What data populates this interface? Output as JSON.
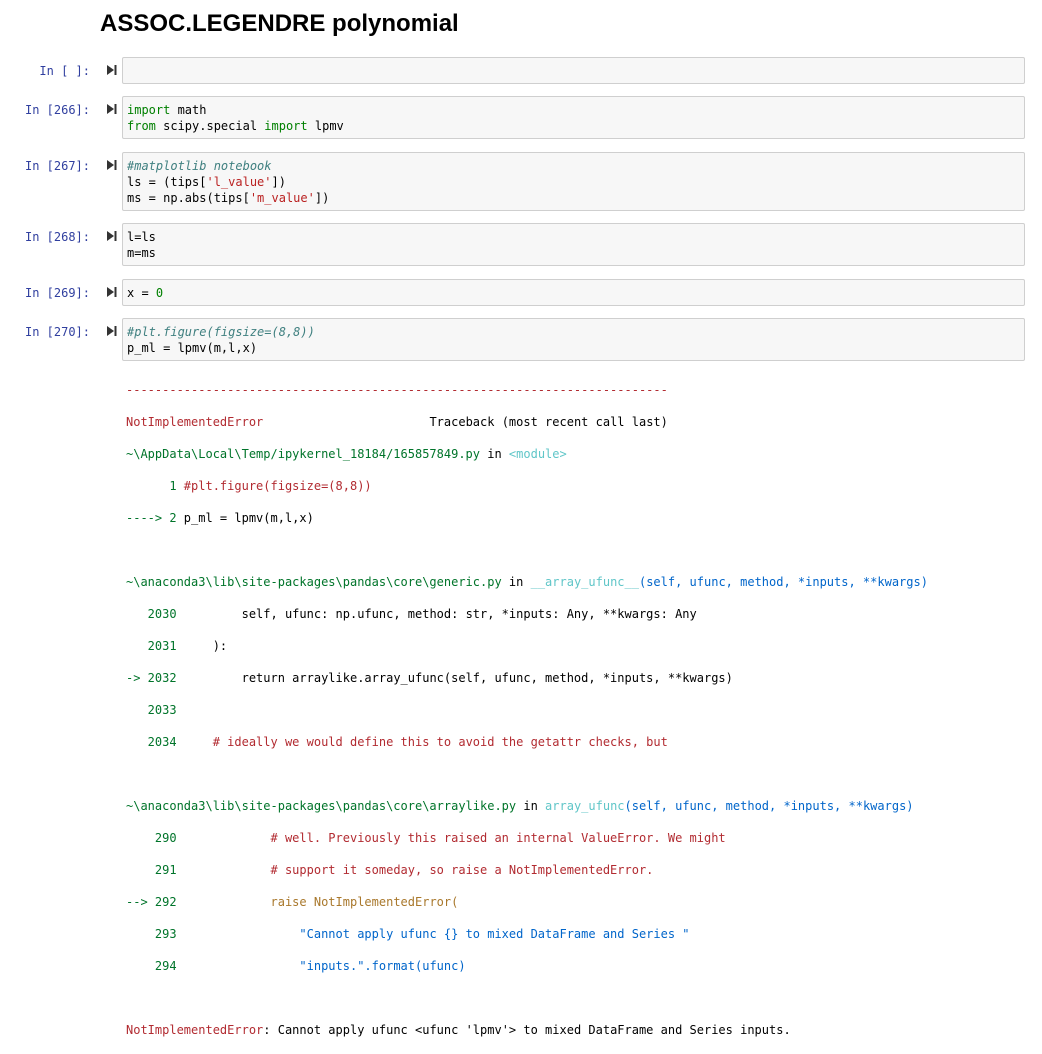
{
  "notebook": {
    "title": "ASSOC.LEGENDRE polynomial",
    "cells": [
      {
        "prompt": "In [ ]:",
        "lines": []
      },
      {
        "prompt": "In [266]:",
        "lines": [
          "import math",
          "from scipy.special import lpmv"
        ]
      },
      {
        "prompt": "In [267]:",
        "lines": [
          "#matplotlib notebook",
          "ls = (tips['l_value'])",
          "ms = np.abs(tips['m_value'])"
        ]
      },
      {
        "prompt": "In [268]:",
        "lines": [
          "l=ls",
          "m=ms"
        ]
      },
      {
        "prompt": "In [269]:",
        "lines": [
          "x = 0"
        ]
      },
      {
        "prompt": "In [270]:",
        "lines": [
          "#plt.figure(figsize=(8,8))",
          "p_ml = lpmv(m,l,x)"
        ]
      }
    ],
    "run_icon": "run-cell-icon"
  },
  "traceback": {
    "separator": "---------------------------------------------------------------------------",
    "error_name": "NotImplementedError",
    "header_right": "Traceback (most recent call last)",
    "frame1": {
      "path": "~\\AppData\\Local\\Temp/ipykernel_18184/165857849.py",
      "in": " in ",
      "func": "<module>",
      "l1_num": "      1",
      "l1_code": " #plt.figure(figsize=(8,8))",
      "l2_arrow": "----> 2",
      "l2_code": " p_ml = lpmv(m,l,x)"
    },
    "frame2": {
      "path": "~\\anaconda3\\lib\\site-packages\\pandas\\core\\generic.py",
      "in": " in ",
      "func": "__array_ufunc__",
      "sig": "(self, ufunc, method, *inputs, **kwargs)",
      "lines": [
        {
          "num": "   2030",
          "code": "         self, ufunc: np.ufunc, method: str, *inputs: Any, **kwargs: Any"
        },
        {
          "num": "   2031",
          "code": "     ):"
        },
        {
          "num": "-> 2032",
          "code": "         return arraylike.array_ufunc(self, ufunc, method, *inputs, **kwargs)"
        },
        {
          "num": "   2033",
          "code": ""
        },
        {
          "num": "   2034",
          "code": "     # ideally we would define this to avoid the getattr checks, but"
        }
      ]
    },
    "frame3": {
      "path": "~\\anaconda3\\lib\\site-packages\\pandas\\core\\arraylike.py",
      "in": " in ",
      "func": "array_ufunc",
      "sig": "(self, ufunc, method, *inputs, **kwargs)",
      "lines": [
        {
          "num": "    290",
          "code": "             # well. Previously this raised an internal ValueError. We might"
        },
        {
          "num": "    291",
          "code": "             # support it someday, so raise a NotImplementedError."
        },
        {
          "num": "--> 292",
          "code": "             raise NotImplementedError("
        },
        {
          "num": "    293",
          "code": "                 \"Cannot apply ufunc {} to mixed DataFrame and Series \""
        },
        {
          "num": "    294",
          "code": "                 \"inputs.\".format(ufunc)"
        }
      ]
    },
    "final_error_name": "NotImplementedError",
    "final_message": ": Cannot apply ufunc <ufunc 'lpmv'> to mixed DataFrame and Series inputs."
  }
}
